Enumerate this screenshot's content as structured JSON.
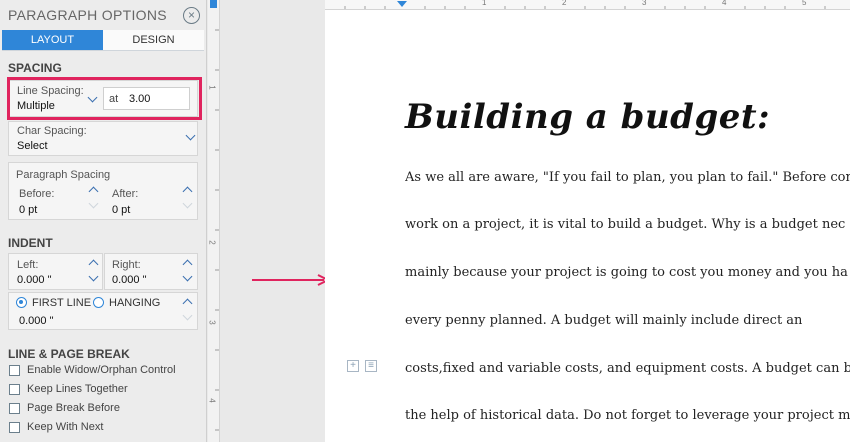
{
  "panel": {
    "title": "PARAGRAPH OPTIONS",
    "tabs": [
      {
        "label": "LAYOUT"
      },
      {
        "label": "DESIGN"
      }
    ]
  },
  "spacing": {
    "section_title": "SPACING",
    "line_spacing_label": "Line Spacing:",
    "line_spacing_value": "Multiple",
    "at_label": "at",
    "at_value": "3.00",
    "char_spacing_label": "Char Spacing:",
    "char_spacing_value": "Select",
    "paragraph_spacing_title": "Paragraph Spacing",
    "before_label": "Before:",
    "before_value": "0  pt",
    "after_label": "After:",
    "after_value": "0  pt"
  },
  "indent": {
    "section_title": "INDENT",
    "left_label": "Left:",
    "left_value": "0.000 \"",
    "right_label": "Right:",
    "right_value": "0.000 \"",
    "first_line_label": "FIRST LINE",
    "hanging_label": "HANGING",
    "special_value": "0.000 \""
  },
  "line_page_break": {
    "section_title": "LINE & PAGE BREAK",
    "options": [
      {
        "label": "Enable Widow/Orphan Control"
      },
      {
        "label": "Keep Lines Together"
      },
      {
        "label": "Page Break Before"
      },
      {
        "label": "Keep With Next"
      }
    ]
  },
  "ruler": {
    "h_ticks": [
      "1",
      "2",
      "3",
      "4",
      "5"
    ],
    "v_ticks": [
      "1",
      "2",
      "3",
      "4"
    ]
  },
  "document": {
    "title": "Building a budget:",
    "lines": [
      "As we all are aware, \"If you fail to plan, you plan to fail.\" Before comm",
      "work on a project, it is vital to build a budget. Why is a budget nec",
      "mainly because your project is going to cost you money and you ha",
      "every penny planned. A budget will mainly include direct an",
      "costs,fixed and variable costs, and equipment costs. A budget can be",
      "the help of historical data. Do not forget to leverage your project ma"
    ]
  },
  "colors": {
    "accent": "#2f86d8",
    "highlight": "#e0245e"
  }
}
